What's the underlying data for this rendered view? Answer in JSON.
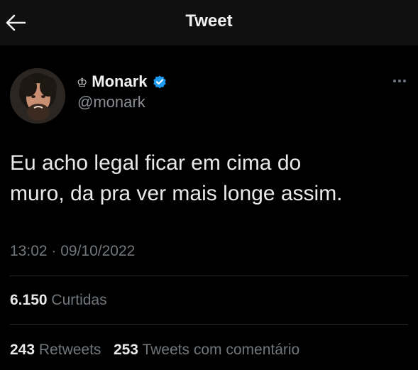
{
  "header": {
    "title": "Tweet",
    "back_icon": "arrow-left-icon"
  },
  "author": {
    "crown": "♔",
    "display_name": "Monark",
    "handle": "@monark",
    "verified": true,
    "verified_color": "#1d9bf0"
  },
  "tweet": {
    "text": "Eu acho legal ficar em cima do\nmuro, da pra ver mais longe assim.",
    "timestamp": "13:02 · 09/10/2022"
  },
  "stats": {
    "likes_count": "6.150",
    "likes_label": "Curtidas",
    "retweets_count": "243",
    "retweets_label": "Retweets",
    "quotes_count": "253",
    "quotes_label": "Tweets com comentário"
  }
}
